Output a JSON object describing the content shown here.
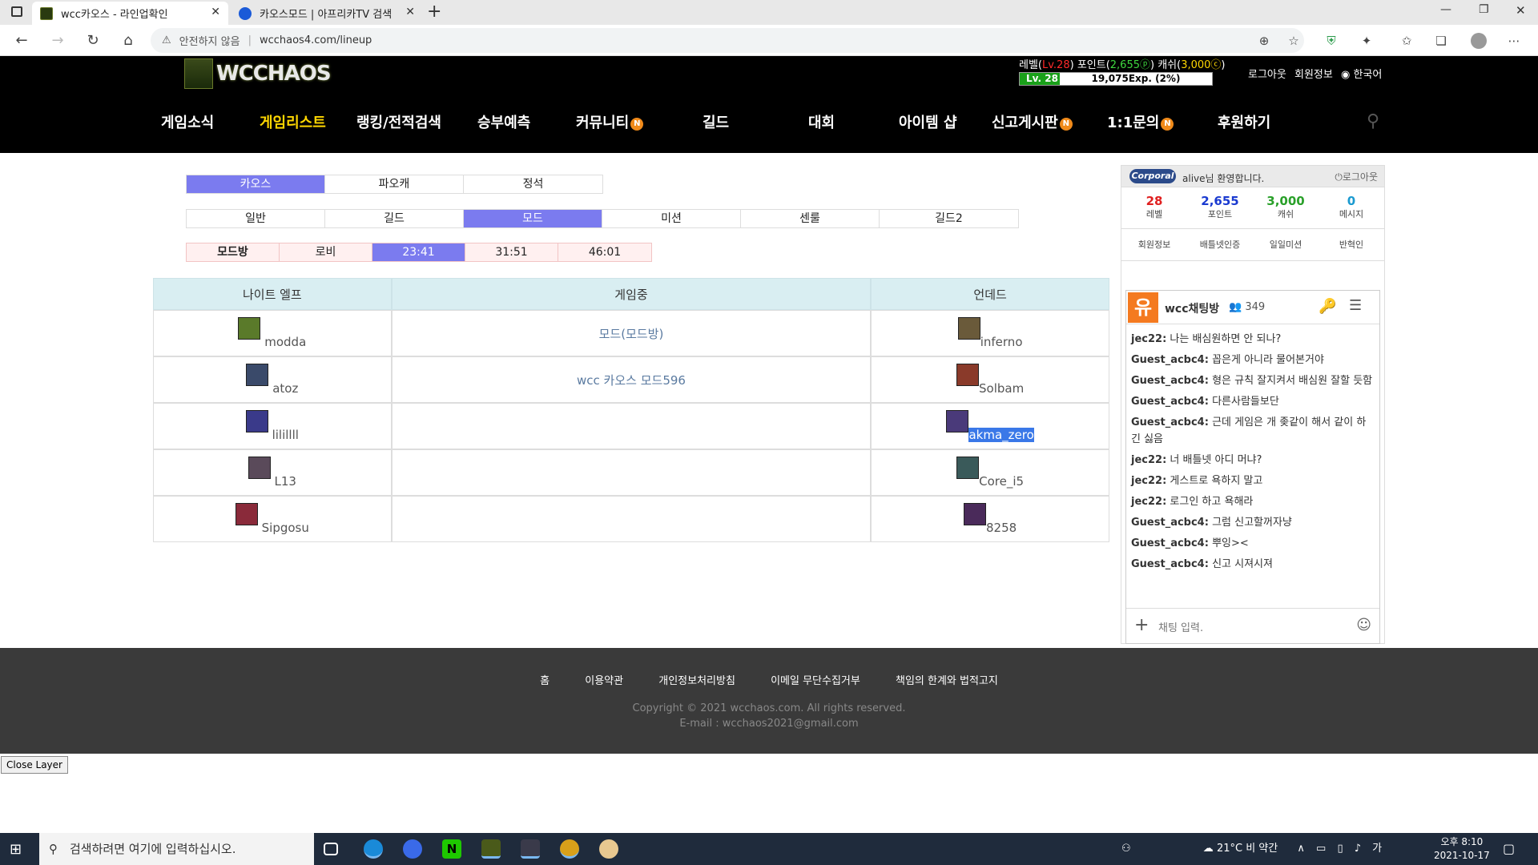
{
  "browser": {
    "tabs": [
      {
        "title": "wcc카오스 - 라인업확인",
        "active": true
      },
      {
        "title": "카오스모드 | 아프리카TV 검색",
        "active": false
      }
    ],
    "security_label": "안전하지 않음",
    "url": "wcchaos4.com/lineup"
  },
  "header": {
    "logo_text": "WCCHAOS",
    "level_label": "레벨(",
    "level_value": "Lv.28",
    "point_label": ") 포인트(",
    "point_value": "2,655ⓟ",
    "cash_label": ") 캐쉬(",
    "cash_value": "3,000ⓒ",
    "close_paren": ")",
    "exp_level": "Lv. 28",
    "exp_text": "19,075Exp. (2%)",
    "exp_percent": 2,
    "logout": "로그아웃",
    "member_info": "회원정보",
    "language": "한국어"
  },
  "nav": {
    "items": [
      "게임소식",
      "게임리스트",
      "랭킹/전적검색",
      "승부예측",
      "커뮤니티",
      "길드",
      "대회",
      "아이템 샵",
      "신고게시판",
      "1:1문의",
      "후원하기"
    ],
    "active": "게임리스트",
    "badge": "N"
  },
  "filters": {
    "row1": [
      "카오스",
      "파오캐",
      "정석"
    ],
    "row1_active": "카오스",
    "row2": [
      "일반",
      "길드",
      "모드",
      "미션",
      "센룰",
      "길드2"
    ],
    "row2_active": "모드",
    "row3": [
      "모드방",
      "로비",
      "23:41",
      "31:51",
      "46:01"
    ],
    "row3_active": "23:41"
  },
  "lineup": {
    "headers": [
      "나이트 엘프",
      "게임중",
      "언데드"
    ],
    "rows": [
      {
        "left": "modda",
        "mid": "모드(모드방)",
        "right": "inferno"
      },
      {
        "left": "atoz",
        "mid": "wcc 카오스 모드596",
        "right": "Solbam"
      },
      {
        "left": "lilillll",
        "mid": "",
        "right": "akma_zero"
      },
      {
        "left": "L13",
        "mid": "",
        "right": "Core_i5"
      },
      {
        "left": "Sipgosu",
        "mid": "",
        "right": "8258"
      }
    ]
  },
  "panel": {
    "rank_badge": "Corporal",
    "welcome": "alive님 환영합니다.",
    "logout": "로그아웃",
    "stats": [
      {
        "value": "28",
        "label": "레벨",
        "color": "#e02020"
      },
      {
        "value": "2,655",
        "label": "포인트",
        "color": "#1a3ad0"
      },
      {
        "value": "3,000",
        "label": "캐쉬",
        "color": "#2aa02a"
      },
      {
        "value": "0",
        "label": "메시지",
        "color": "#1a9ad0"
      }
    ],
    "links": [
      "회원정보",
      "배틀넷인증",
      "일일미션",
      "반혁인"
    ],
    "chat": {
      "title": "wcc채팅방",
      "count": "349",
      "messages": [
        {
          "user": "jec22:",
          "text": "나는 배심원하면 안 되나?"
        },
        {
          "user": "Guest_acbc4:",
          "text": "꼽은게 아니라 물어본거야"
        },
        {
          "user": "Guest_acbc4:",
          "text": "형은 규칙 잘지켜서 배심원 잘할 듯함"
        },
        {
          "user": "Guest_acbc4:",
          "text": "다른사람들보단"
        },
        {
          "user": "Guest_acbc4:",
          "text": "근데 게임은 개 좆같이 해서 같이 하긴 싫음"
        },
        {
          "user": "jec22:",
          "text": "너 배틀넷 아디 머냐?"
        },
        {
          "user": "jec22:",
          "text": "게스트로 욕하지 말고"
        },
        {
          "user": "jec22:",
          "text": "로그인 하고 욕해라"
        },
        {
          "user": "Guest_acbc4:",
          "text": "그럼 신고할꺼자냥"
        },
        {
          "user": "Guest_acbc4:",
          "text": "뿌잉><"
        },
        {
          "user": "Guest_acbc4:",
          "text": "신고 시져시져"
        }
      ],
      "input_placeholder": "채팅 입력."
    }
  },
  "footer": {
    "links": [
      "홈",
      "이용약관",
      "개인정보처리방침",
      "이메일 무단수집거부",
      "책임의 한계와 법적고지"
    ],
    "copyright": "Copyright © 2021 wcchaos.com. All rights reserved.",
    "email": "E-mail : wcchaos2021@gmail.com"
  },
  "close_layer": "Close Layer",
  "taskbar": {
    "search_placeholder": "검색하려면 여기에 입력하십시오.",
    "weather": "21°C 비 약간",
    "time": "오후 8:10",
    "date": "2021-10-17"
  }
}
